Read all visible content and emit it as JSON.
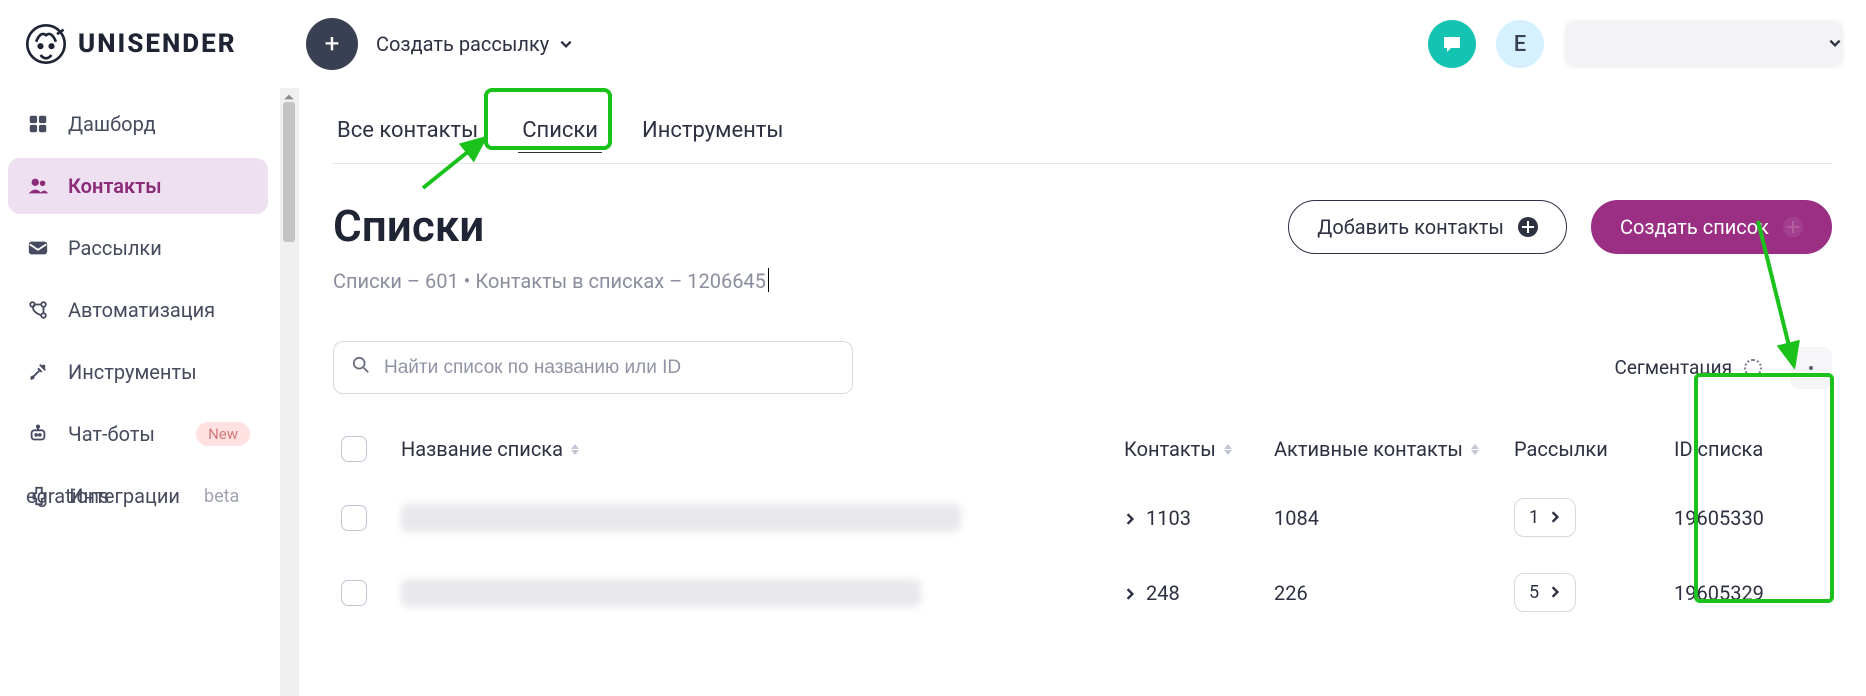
{
  "logo_text": "UNISENDER",
  "create_campaign_label": "Создать рассылку",
  "avatar_letter": "E",
  "sidebar": {
    "items": [
      {
        "label": "Дашборд"
      },
      {
        "label": "Контакты"
      },
      {
        "label": "Рассылки"
      },
      {
        "label": "Автоматизация"
      },
      {
        "label": "Инструменты"
      },
      {
        "label": "Чат-боты"
      },
      {
        "label": "Интеграции"
      }
    ],
    "badge_new": "New",
    "badge_beta": "beta"
  },
  "tabs": {
    "all_contacts": "Все контакты",
    "lists": "Списки",
    "tools": "Инструменты"
  },
  "page": {
    "title": "Списки",
    "subtitle": "Списки – 601 • Контакты в списках – 1206645",
    "add_contacts": "Добавить контакты",
    "create_list": "Создать список"
  },
  "toolbar": {
    "search_placeholder": "Найти список по названию или ID",
    "segmentation_label": "Сегментация"
  },
  "table": {
    "columns": {
      "name": "Название списка",
      "contacts": "Контакты",
      "active": "Активные контакты",
      "mailings": "Рассылки",
      "id": "ID списка"
    },
    "rows": [
      {
        "contacts": "1103",
        "active": "1084",
        "mailings": "1",
        "id": "19605330"
      },
      {
        "contacts": "248",
        "active": "226",
        "mailings": "5",
        "id": "19605329"
      }
    ]
  }
}
